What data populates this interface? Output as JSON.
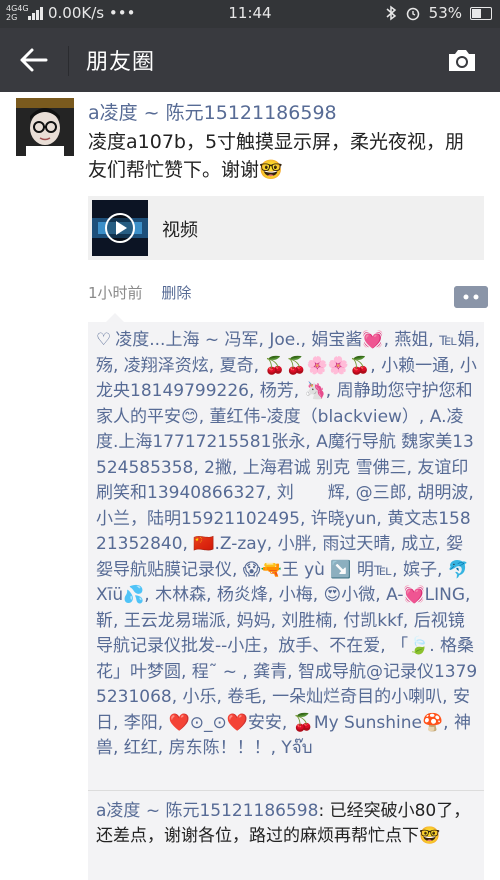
{
  "status": {
    "network": "4G4G 2G",
    "speed": "0.00K/s •••",
    "time": "11:44",
    "battery": "53%",
    "battery_level": 0.53
  },
  "nav": {
    "title": "朋友圈"
  },
  "post": {
    "author": "a凌度 ~ 陈元15121186598",
    "text": "凌度a107b，5寸触摸显示屏，柔光夜视，朋友们帮忙赞下。谢谢🤓",
    "video_label": "视频",
    "time_ago": "1小时前",
    "delete_label": "删除"
  },
  "likes": {
    "heart": "♡",
    "text": "凌度...上海 ~ 冯军, Joe., 娟宝酱💓, 燕姐, ℡娟, 殇, 凌翔泽资炫, 夏奇, 🍒🍒🌸🌸🍒, 小赖一通, 小龙央18149799226, 杨芳, 🦄, 周静助您守护您和家人的平安😊, 董红伟-凌度（blackview）, A.凌度.上海17717215581张永, A魔行导航 魏家美13524585358, 2撇, 上海君诚 别克 雪佛三, 友谊印刷笑和13940866327, 刘　　辉, @三郎, 胡明波, 小兰，陆明15921102495, 许晓yun, 黄文志15821352840, 🇨🇳.Z-zay, 小胖, 雨过天晴, 成立, 妴妴导航贴膜记录仪, 😱🔫王 yù ↘️ 明℡, 嫔子, 🐬Xīü💦, 木林森, 杨炎烽, 小梅, 😍小微, A-💓LING, 靳, 王云龙易瑞派, 妈妈, 刘胜楠, 付凯kkf, 后视镜导航记录仪批发--小庄，放手、不在爱, 「🍃. 格桑花」叶梦圆, 程˜ ~ , 龚青, 智成导航@记录仪13795231068, 小乐, 卷毛, 一朵灿烂奇目的小喇叭, 安日, 李阳, ❤️⊙_⊙❤️安安, 🍒My Sunshine🍄, 神兽, 红红, 房东陈！！！, Yจ๊บ"
  },
  "comment": {
    "author": "a凌度 ~ 陈元15121186598",
    "text": ": 已经突破小80了，还差点，谢谢各位，路过的麻烦再帮忙点下🤓"
  },
  "icons": {
    "back": "back-arrow-icon",
    "camera": "camera-icon",
    "play": "play-icon",
    "more": "more-icon",
    "bluetooth": "bluetooth-icon",
    "alarm": "alarm-icon"
  },
  "colors": {
    "link": "#576b95",
    "navbar": "#393a3f",
    "statusbar": "#333538",
    "likes_bg": "#f3f3f5"
  }
}
